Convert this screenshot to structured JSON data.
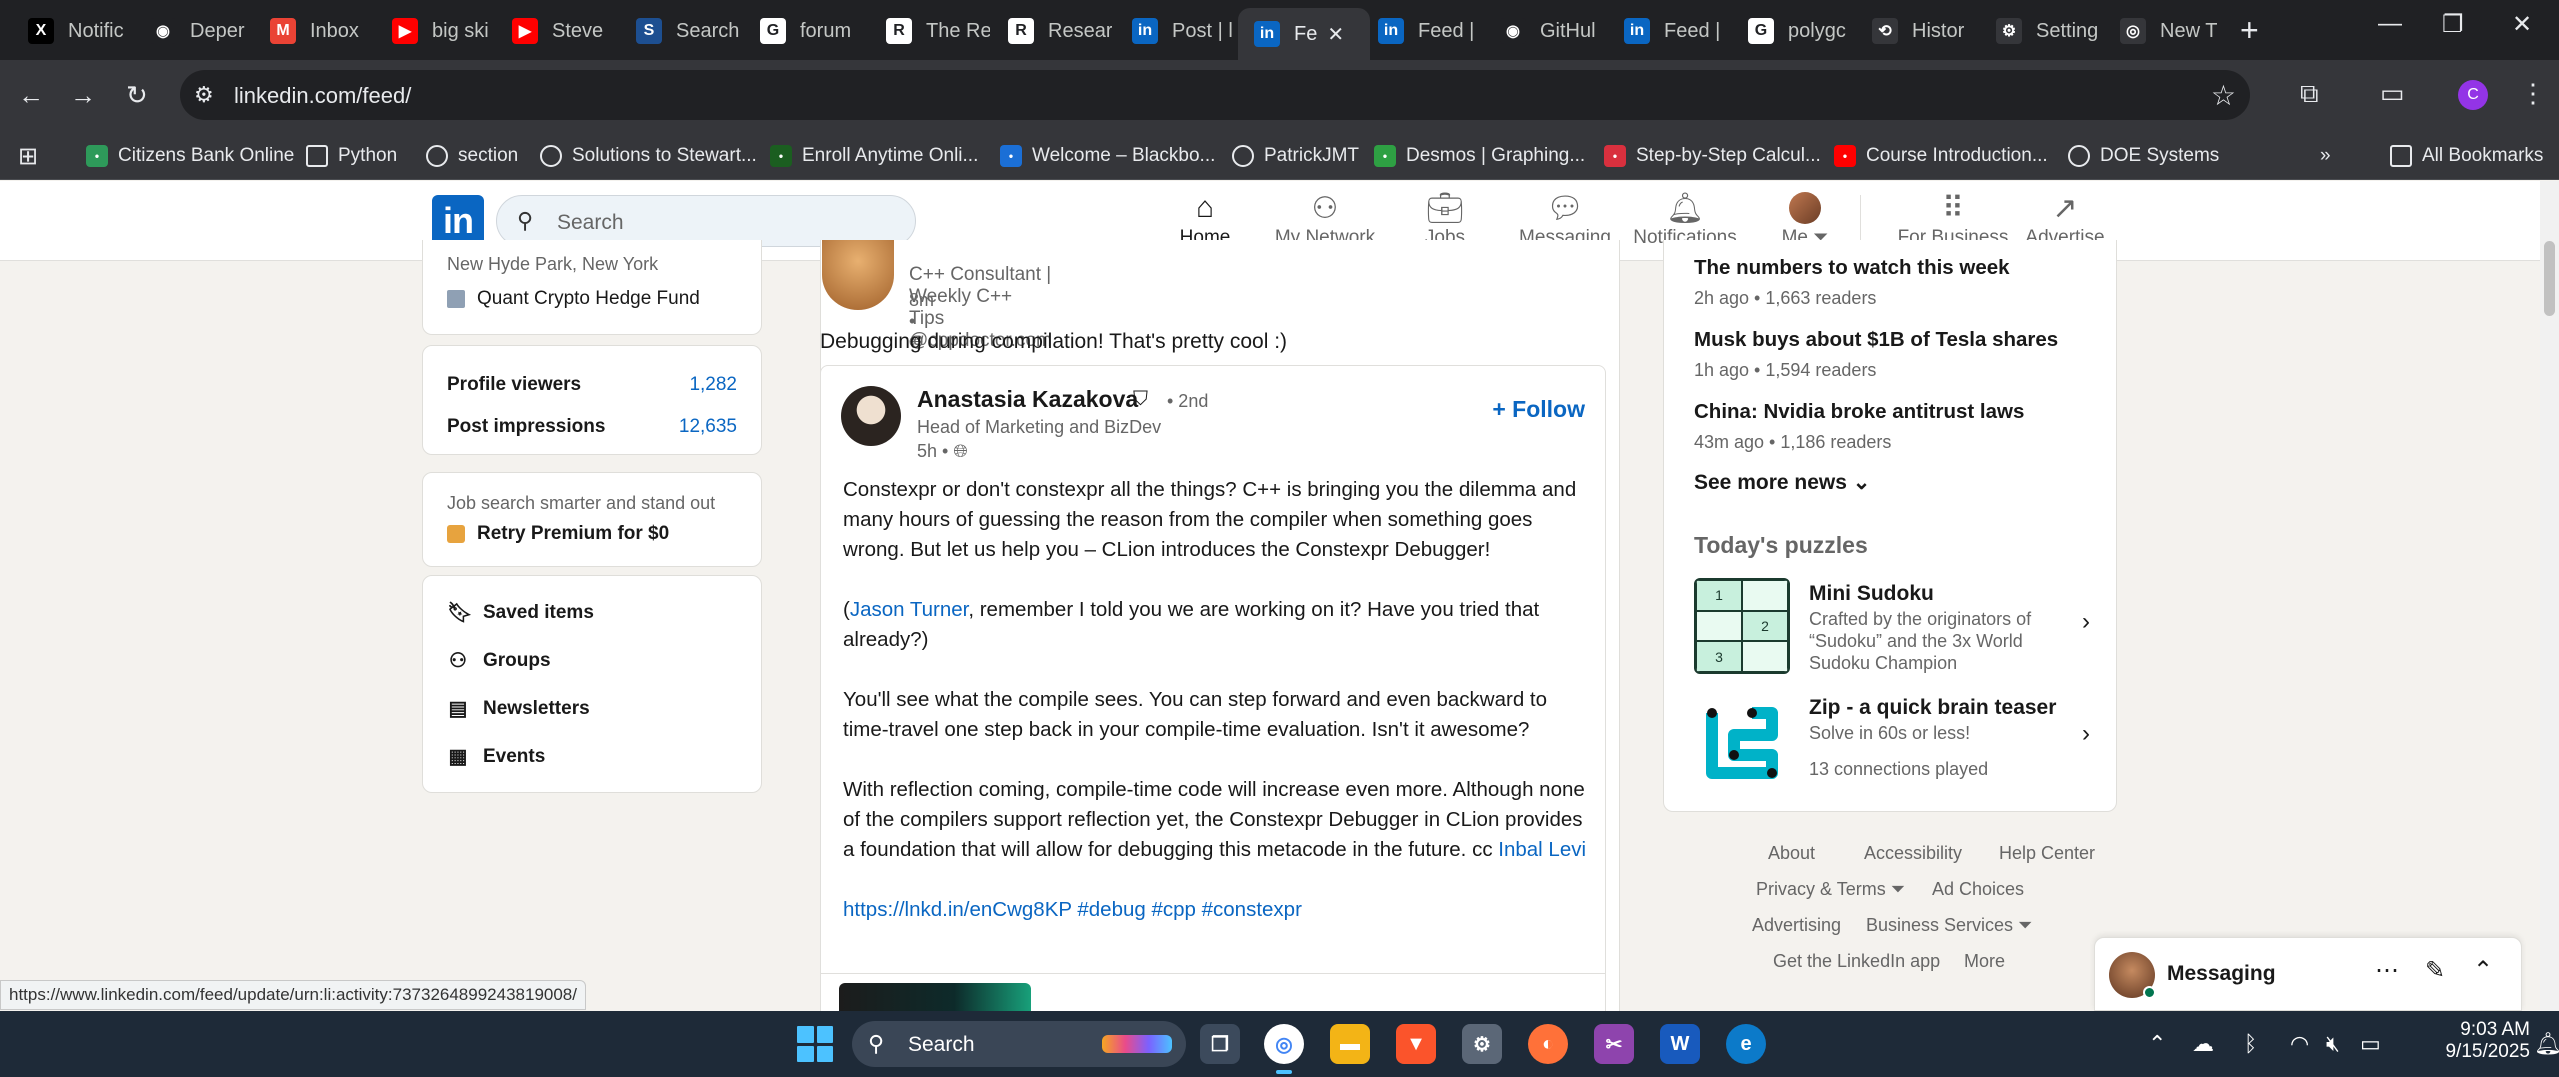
{
  "browser": {
    "tabs": [
      {
        "title": "Notific",
        "icon": "x-logo-icon",
        "color": "#000000",
        "glyph": "X"
      },
      {
        "title": "Deper",
        "icon": "github-icon",
        "color": "#202124",
        "glyph": "◉"
      },
      {
        "title": "Inbox",
        "icon": "gmail-icon",
        "color": "#ea4335",
        "glyph": "M"
      },
      {
        "title": "big ski",
        "icon": "youtube-icon",
        "color": "#ff0000",
        "glyph": "▶"
      },
      {
        "title": "Steve",
        "icon": "youtube-icon",
        "color": "#ff0000",
        "glyph": "▶"
      },
      {
        "title": "Search",
        "icon": "ssrn-icon",
        "color": "#1d4f91",
        "glyph": "S"
      },
      {
        "title": "forum",
        "icon": "google-icon",
        "color": "#ffffff",
        "glyph": "G"
      },
      {
        "title": "The Re",
        "icon": "research-r-icon",
        "color": "#ffffff",
        "glyph": "R"
      },
      {
        "title": "Resear",
        "icon": "research-r-icon",
        "color": "#ffffff",
        "glyph": "R"
      },
      {
        "title": "Post | l",
        "icon": "linkedin-icon",
        "color": "#0a66c2",
        "glyph": "in"
      },
      {
        "title": "Fe",
        "icon": "linkedin-icon",
        "color": "#0a66c2",
        "glyph": "in"
      },
      {
        "title": "Feed |",
        "icon": "linkedin-icon",
        "color": "#0a66c2",
        "glyph": "in"
      },
      {
        "title": "GitHul",
        "icon": "github-icon",
        "color": "#202124",
        "glyph": "◉"
      },
      {
        "title": "Feed |",
        "icon": "linkedin-icon",
        "color": "#0a66c2",
        "glyph": "in"
      },
      {
        "title": "polygc",
        "icon": "google-icon",
        "color": "#ffffff",
        "glyph": "G"
      },
      {
        "title": "Histor",
        "icon": "history-icon",
        "color": "#35363a",
        "glyph": "⟲"
      },
      {
        "title": "Setting",
        "icon": "gear-icon",
        "color": "#35363a",
        "glyph": "⚙"
      },
      {
        "title": "New T",
        "icon": "chrome-icon",
        "color": "#35363a",
        "glyph": "◎"
      }
    ],
    "url": "linkedin.com/feed/",
    "profile_initial": "C",
    "bookmarks": [
      {
        "label": "Citizens Bank Online",
        "icon": "citizens-bank-icon",
        "color": "#2e9a5a"
      },
      {
        "label": "Python",
        "icon": "folder-icon",
        "color": ""
      },
      {
        "label": "section",
        "icon": "globe-icon",
        "color": ""
      },
      {
        "label": "Solutions to Stewart...",
        "icon": "globe-icon",
        "color": ""
      },
      {
        "label": "Enroll Anytime Onli...",
        "icon": "unh-icon",
        "color": "#1b5e20"
      },
      {
        "label": "Welcome – Blackbo...",
        "icon": "blackboard-icon",
        "color": "#1b6fd6"
      },
      {
        "label": "PatrickJMT",
        "icon": "globe-icon",
        "color": ""
      },
      {
        "label": "Desmos | Graphing...",
        "icon": "desmos-icon",
        "color": "#2ea043"
      },
      {
        "label": "Step-by-Step Calcul...",
        "icon": "symbolab-icon",
        "color": "#d9303e"
      },
      {
        "label": "Course Introduction...",
        "icon": "youtube-icon",
        "color": "#ff0000"
      },
      {
        "label": "DOE Systems",
        "icon": "doe-shield-icon",
        "color": ""
      }
    ],
    "all_bookmarks": "All Bookmarks",
    "status_url": "https://www.linkedin.com/feed/update/urn:li:activity:7373264899243819008/"
  },
  "linkedin": {
    "logo": "in",
    "search_placeholder": "Search",
    "nav": [
      {
        "label": "Home",
        "icon": "home-icon"
      },
      {
        "label": "My Network",
        "icon": "network-icon"
      },
      {
        "label": "Jobs",
        "icon": "briefcase-icon"
      },
      {
        "label": "Messaging",
        "icon": "chat-icon"
      },
      {
        "label": "Notifications",
        "icon": "bell-icon"
      },
      {
        "label": "Me ⏷",
        "icon": "avatar"
      },
      {
        "label": "For Business ⏷",
        "icon": "grid-icon"
      },
      {
        "label": "Advertise",
        "icon": "advertise-icon"
      }
    ],
    "profile": {
      "location": "New Hyde Park, New York",
      "company": "Quant Crypto Hedge Fund"
    },
    "stats": [
      {
        "label": "Profile viewers",
        "value": "1,282"
      },
      {
        "label": "Post impressions",
        "value": "12,635"
      }
    ],
    "premium": {
      "line1": "Job search smarter and stand out",
      "line2": "Retry Premium for $0"
    },
    "menu": [
      {
        "label": "Saved items",
        "icon": "bookmark-icon"
      },
      {
        "label": "Groups",
        "icon": "groups-icon"
      },
      {
        "label": "Newsletters",
        "icon": "newsletter-icon"
      },
      {
        "label": "Events",
        "icon": "calendar-icon"
      }
    ],
    "post": {
      "author_subtitle": "C++ Consultant | Weekly C++ Tips @cppdoctor.com",
      "time": "8m •",
      "text": "Debugging during compilation! That's pretty cool :)",
      "shared": {
        "name": "Anastasia Kazakova",
        "degree": "• 2nd",
        "headline": "Head of Marketing and BizDev",
        "time": "5h •",
        "follow": "+ Follow",
        "p1": "Constexpr or don't constexpr all the things? C++ is bringing you the dilemma and many hours of guessing the reason from the compiler when something goes wrong. But let us help you – CLion introduces the Constexpr Debugger!",
        "p2_open": "(",
        "p2_mention": "Jason Turner",
        "p2_rest": ", remember I told you we are working on it? Have you tried that already?)",
        "p3": "You'll see what the compile sees. You can step forward and even backward to time-travel one step back in your compile-time evaluation. Isn't it awesome?",
        "p4": "With reflection coming, compile-time code will increase even more. Although none of the compilers support reflection yet, the Constexpr Debugger in CLion provides a foundation that will allow for debugging this metacode in the future. cc ",
        "p4_mention": "Inbal Levi",
        "link_line": "https://lnkd.in/enCwg8KP #debug #cpp #constexpr"
      }
    },
    "news": [
      {
        "title": "The numbers to watch this week",
        "meta": "2h ago • 1,663 readers"
      },
      {
        "title": "Musk buys about $1B of Tesla shares",
        "meta": "1h ago • 1,594 readers"
      },
      {
        "title": "China: Nvidia broke antitrust laws",
        "meta": "43m ago • 1,186 readers"
      }
    ],
    "see_more": "See more news ⌄",
    "puzzles_heading": "Today's puzzles",
    "puzzles": [
      {
        "title": "Mini Sudoku",
        "desc": "Crafted by the originators of “Sudoku” and the 3x World Sudoku Champion"
      },
      {
        "title": "Zip - a quick brain teaser",
        "desc": "Solve in 60s or less!",
        "extra": "13 connections played"
      }
    ],
    "sudoku_cells": [
      "1",
      "",
      "",
      "2",
      "3",
      ""
    ],
    "footer": {
      "about": "About",
      "accessibility": "Accessibility",
      "help": "Help Center",
      "privacy": "Privacy & Terms ⏷",
      "adchoices": "Ad Choices",
      "advertising": "Advertising",
      "business": "Business Services ⏷",
      "app": "Get the LinkedIn app",
      "more": "More"
    },
    "messaging": "Messaging"
  },
  "taskbar": {
    "search": "Search",
    "time": "9:03 AM",
    "date": "9/15/2025"
  }
}
